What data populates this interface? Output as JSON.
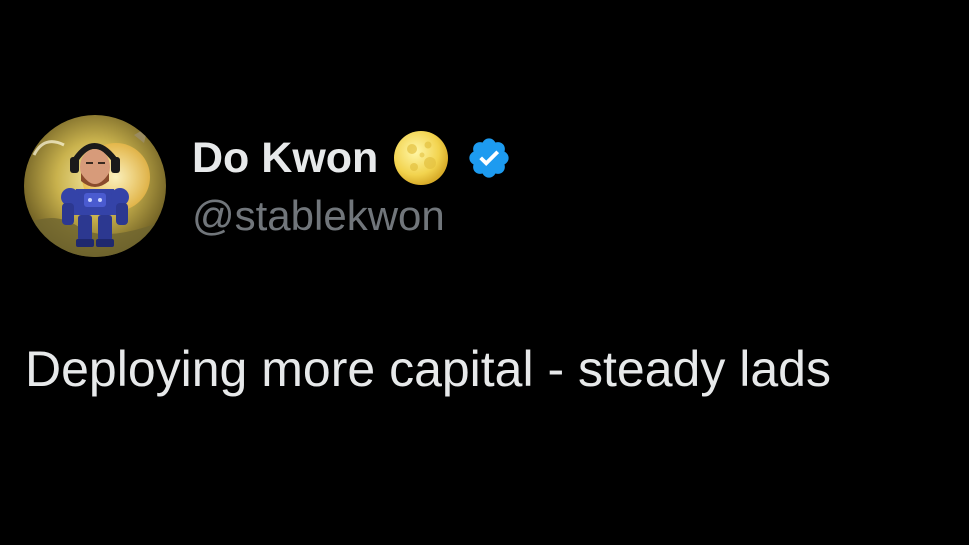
{
  "author": {
    "display_name": "Do Kwon",
    "handle": "@stablekwon",
    "name_emoji": "full-moon-emoji",
    "verified": true,
    "verified_color": "#1d9bf0",
    "avatar_icon": "profile-avatar"
  },
  "tweet": {
    "text": "Deploying more capital - steady lads"
  },
  "colors": {
    "background": "#000000",
    "primary_text": "#e7e9ea",
    "secondary_text": "#71767b",
    "accent": "#1d9bf0"
  }
}
